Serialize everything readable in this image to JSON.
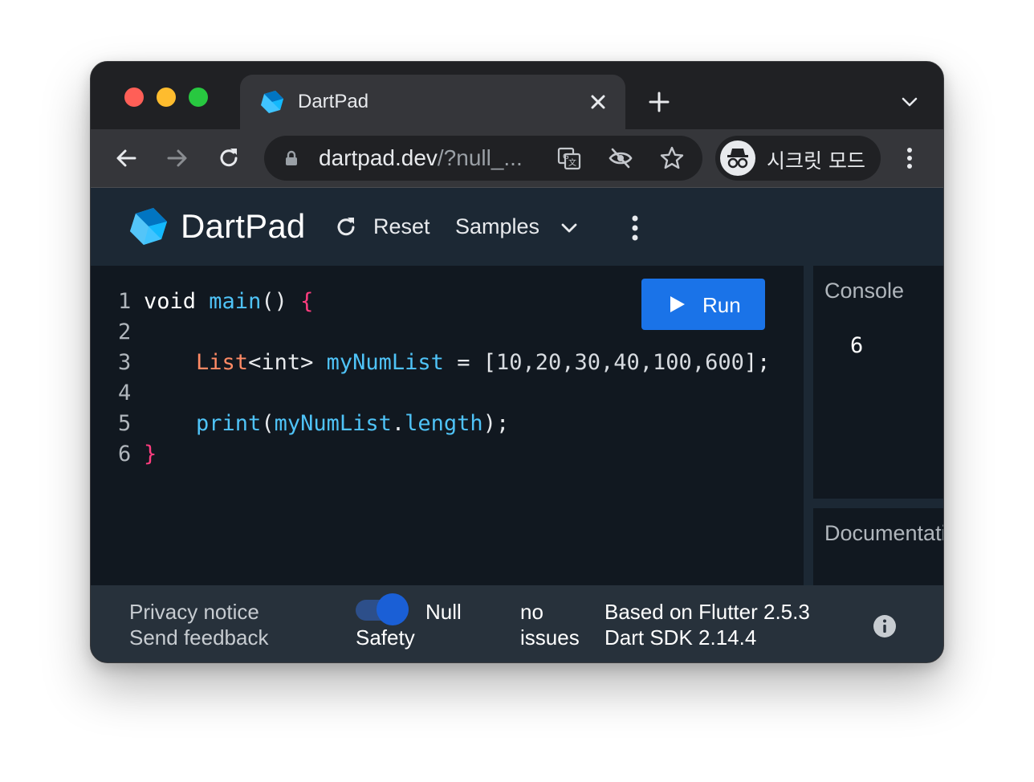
{
  "browser": {
    "tab": {
      "title": "DartPad"
    },
    "url": {
      "host": "dartpad.dev",
      "rest": "/?null_..."
    },
    "profile": {
      "label": "시크릿 모드"
    }
  },
  "header": {
    "title": "DartPad",
    "reset_label": "Reset",
    "samples_label": "Samples"
  },
  "editor": {
    "run_label": "Run",
    "lines": [
      {
        "n": "1"
      },
      {
        "n": "2"
      },
      {
        "n": "3"
      },
      {
        "n": "4"
      },
      {
        "n": "5"
      },
      {
        "n": "6"
      }
    ],
    "tokens": {
      "void": "void",
      "main": "main",
      "parens": "()",
      "open_brace": "{",
      "list": "List",
      "generic": "<int>",
      "var_name": "myNumList",
      "assign": "=",
      "open_bracket": "[",
      "numbers": "10,20,30,40,100,600",
      "close_bracket": "];",
      "print": "print",
      "open_paren": "(",
      "arg": "myNumList",
      "dot": ".",
      "prop": "length",
      "close_stmt": ");",
      "close_brace": "}"
    }
  },
  "console": {
    "title": "Console",
    "output": "6"
  },
  "docs": {
    "title": "Documentation"
  },
  "footer": {
    "privacy": "Privacy notice",
    "feedback": "Send feedback",
    "null_label_1": "Null",
    "null_label_2": "Safety",
    "issues_1": "no",
    "issues_2": "issues",
    "flutter_version": "Based on Flutter 2.5.3",
    "sdk_version": "Dart SDK 2.14.4"
  },
  "colors": {
    "accent": "#1a73e8",
    "function": "#4fc3f7",
    "type": "#ff8a65",
    "brace": "#ff3d7f"
  },
  "icons": [
    "dart-logo-icon",
    "close-icon",
    "plus-icon",
    "chevron-down-icon",
    "back-arrow-icon",
    "forward-arrow-icon",
    "reload-icon",
    "lock-icon",
    "translate-icon",
    "eye-off-icon",
    "star-icon",
    "incognito-icon",
    "kebab-menu-icon",
    "refresh-icon",
    "play-icon",
    "info-icon"
  ]
}
